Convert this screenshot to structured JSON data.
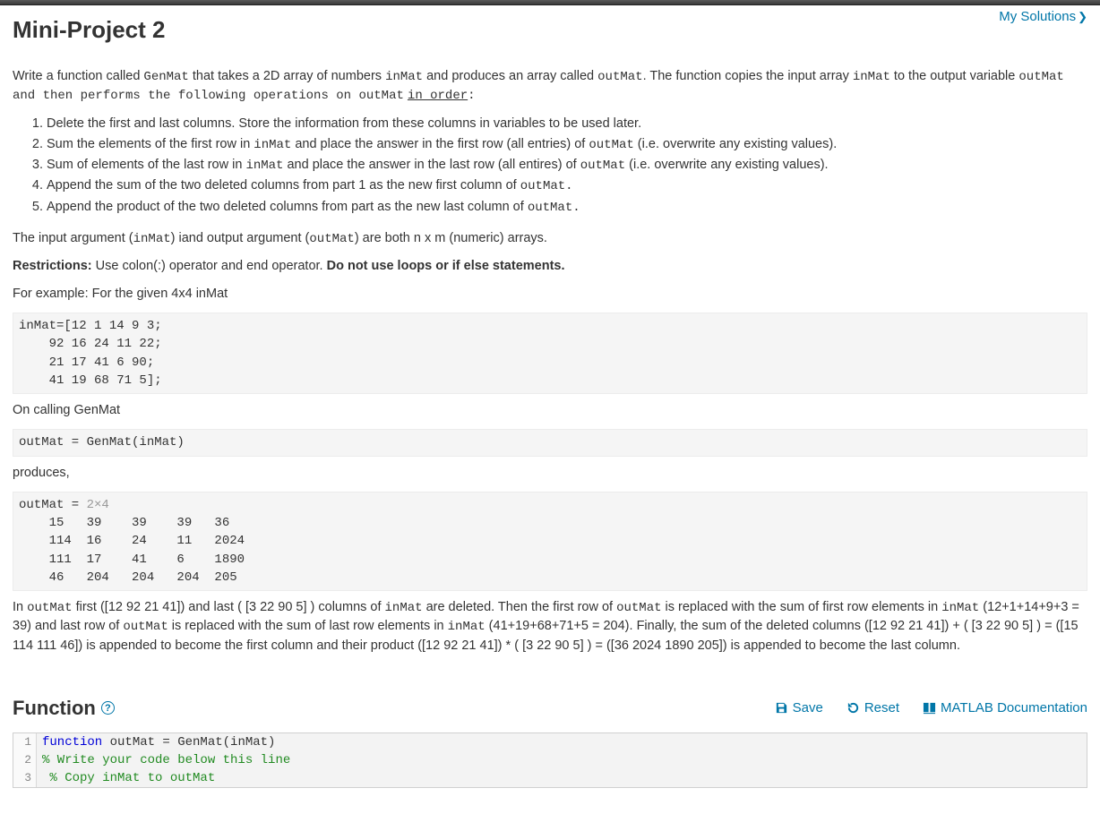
{
  "header": {
    "title": "Mini-Project 2",
    "my_solutions": "My Solutions"
  },
  "intro": {
    "part1": "Write a function called ",
    "fn": "GenMat",
    "part2": " that takes a 2D array of numbers ",
    "inmat": "inMat",
    "part3": " and produces an array called ",
    "outmat": "outMat",
    "part4": ".  The function copies the input array ",
    "part5": " to the output variable ",
    "part6": " and then performs the following operations on ",
    "in_order": "in order",
    "colon": ":"
  },
  "steps": {
    "s1": "Delete the first and last columns. Store the information from these columns in variables to be used later.",
    "s2a": "Sum the elements of the first row in ",
    "s2b": " and place the answer in the first row (all entries) of ",
    "s2c": " (i.e. overwrite any existing values).",
    "s3a": "Sum of elements of the last row in ",
    "s3b": " and place the answer in the last row (all entires) of ",
    "s3c": " (i.e. overwrite any existing values).",
    "s4a": "Append the sum of the two deleted columns from part 1 as the new first column of ",
    "s4dot": ".",
    "s5a": "Append the product of the two deleted columns from part as the new last column of "
  },
  "args": {
    "a": "The input argument (",
    "b": ") iand output argument (",
    "c": ") are both n x m (numeric) arrays."
  },
  "restrictions": {
    "label": "Restrictions:",
    "text": "  Use colon(:) operator and end operator. ",
    "bold": "Do not use loops or if else statements."
  },
  "example": {
    "intro": "For example: For the given 4x4 inMat",
    "inmat_block": "inMat=[12 1 14 9 3;\n    92 16 24 11 22;\n    21 17 41 6 90;\n    41 19 68 71 5];",
    "calling": "On calling GenMat",
    "call_block": "outMat = GenMat(inMat)",
    "produces": "produces,",
    "out_prefix": "outMat = ",
    "out_dim": "2×4",
    "out_body": "    15   39    39    39   36\n    114  16    24    11   2024\n    111  17    41    6    1890\n    46   204   204   204  205"
  },
  "explain": {
    "a": "In ",
    "b": " first ([12 92 21 41]) and last ( [3 22 90 5] ) columns of ",
    "c": " are deleted. Then the first row of ",
    "d": " is replaced with the sum of first row elements in ",
    "e": " (12+1+14+9+3 = 39) and last row of ",
    "f": " is replaced with the sum of last row elements in ",
    "g": "  (41+19+68+71+5 = 204). Finally, the sum of the deleted columns  ([12 92 21 41]) + ( [3 22 90 5] ) = ([15 114 111 46]) is appended to become the first column and their product ([12 92 21 41]) * ( [3 22 90 5] ) = ([36 2024 1890 205]) is appended to become the last column."
  },
  "function_section": {
    "heading": "Function",
    "save": "Save",
    "reset": "Reset",
    "docs": "MATLAB Documentation"
  },
  "code": {
    "ln1": "1",
    "ln2": "2",
    "ln3": "3",
    "l1_kw": "function",
    "l1_rest": " outMat = GenMat(inMat)",
    "l2": "% Write your code below this line",
    "l3": " % Copy inMat to outMat"
  }
}
